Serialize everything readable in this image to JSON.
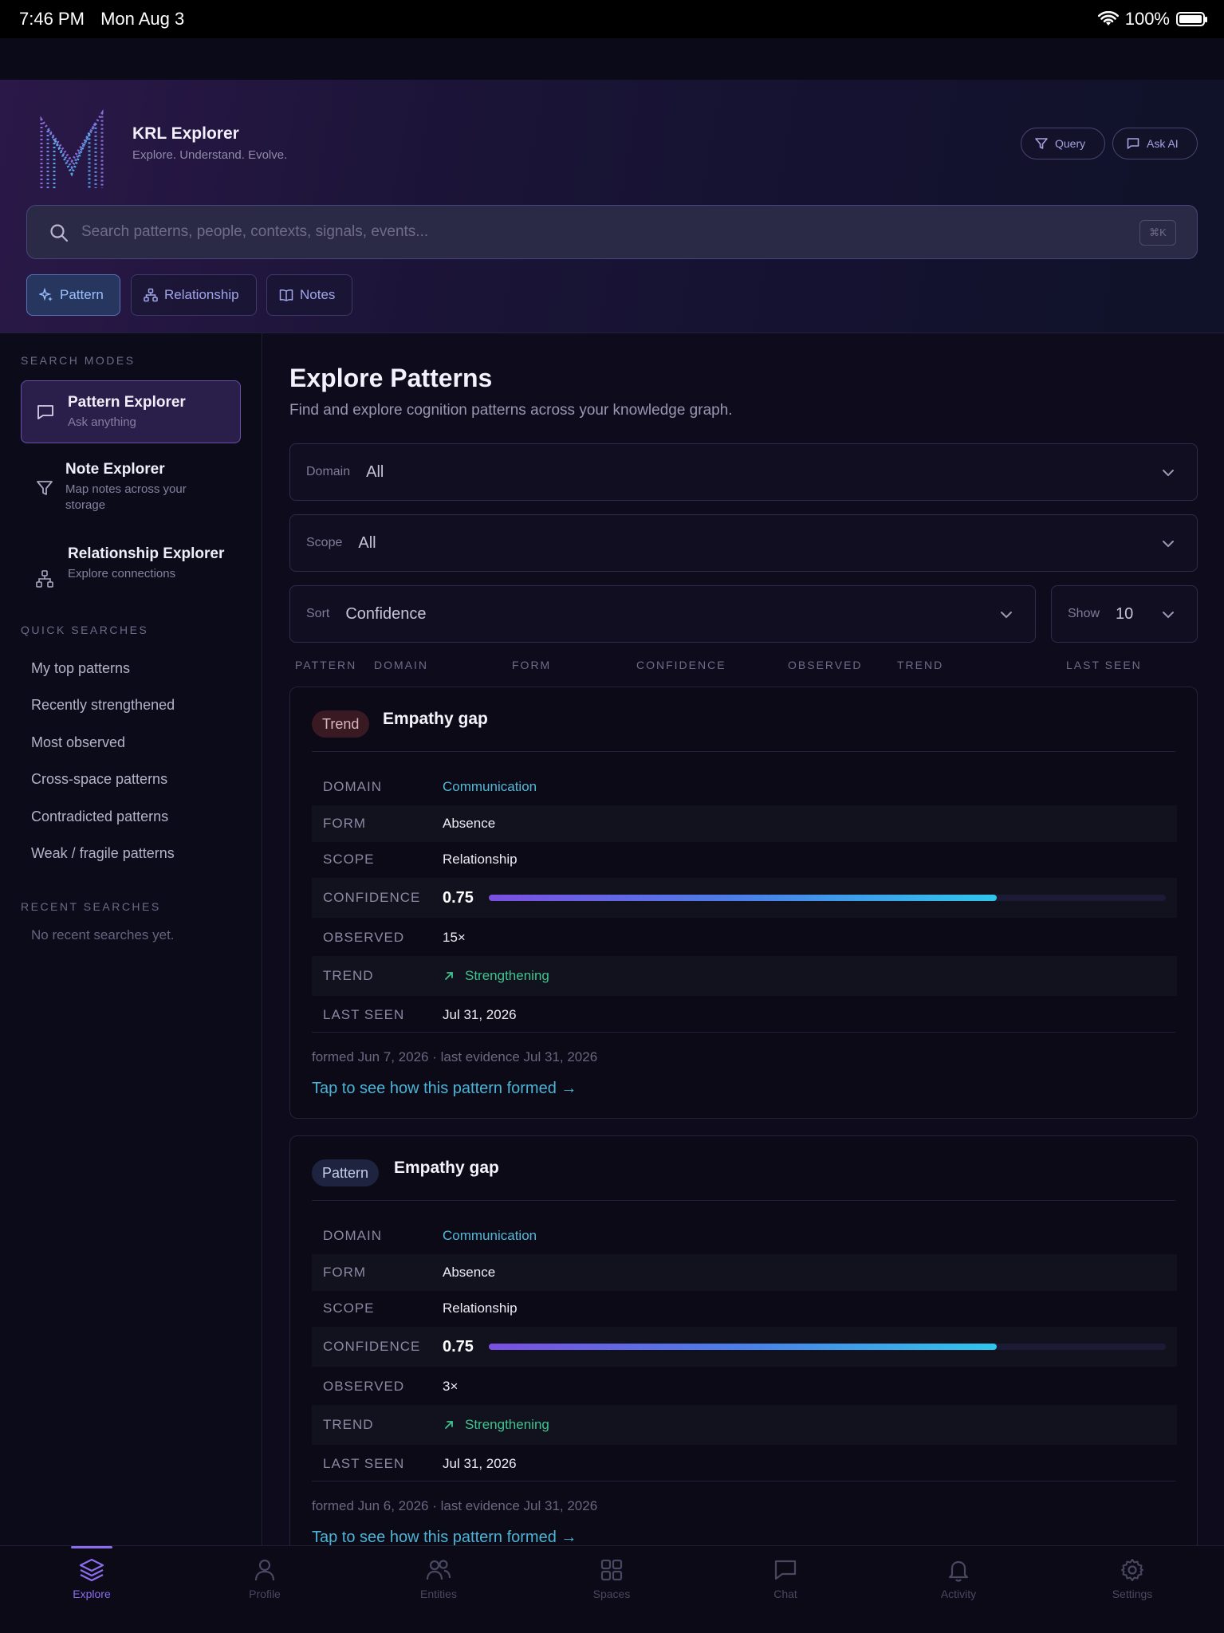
{
  "status": {
    "time": "7:46 PM",
    "date": "Mon Aug 3",
    "battery": "100%"
  },
  "brand": {
    "title": "KRL Explorer",
    "subtitle": "Explore. Understand. Evolve."
  },
  "header_buttons": {
    "query": "Query",
    "ask_ai": "Ask AI"
  },
  "search": {
    "placeholder": "Search patterns, people, contexts, signals, events...",
    "shortcut": "⌘K"
  },
  "tabs": [
    {
      "label": "Pattern",
      "active": true
    },
    {
      "label": "Relationship",
      "active": false
    },
    {
      "label": "Notes",
      "active": false
    }
  ],
  "sidebar": {
    "search_modes_label": "SEARCH MODES",
    "modes": [
      {
        "title": "Pattern Explorer",
        "subtitle": "Ask anything",
        "active": true
      },
      {
        "title": "Note Explorer",
        "subtitle": "Map notes across your storage",
        "active": false
      },
      {
        "title": "Relationship Explorer",
        "subtitle": "Explore connections",
        "active": false
      }
    ],
    "quick_label": "QUICK SEARCHES",
    "quick": [
      "My top patterns",
      "Recently strengthened",
      "Most observed",
      "Cross-space patterns",
      "Contradicted patterns",
      "Weak / fragile patterns"
    ],
    "recent_label": "RECENT SEARCHES",
    "recent_empty": "No recent searches yet."
  },
  "main": {
    "title": "Explore Patterns",
    "subtitle": "Find and explore cognition patterns across your knowledge graph.",
    "filters": {
      "domain_label": "Domain",
      "domain_value": "All",
      "scope_label": "Scope",
      "scope_value": "All",
      "sort_label": "Sort",
      "sort_value": "Confidence",
      "show_label": "Show",
      "show_value": "10"
    },
    "columns": [
      "PATTERN",
      "DOMAIN",
      "FORM",
      "CONFIDENCE",
      "OBSERVED",
      "TREND",
      "LAST SEEN"
    ]
  },
  "field_labels": {
    "domain": "DOMAIN",
    "form": "FORM",
    "scope": "SCOPE",
    "confidence": "CONFIDENCE",
    "observed": "OBSERVED",
    "trend": "TREND",
    "last_seen": "LAST SEEN"
  },
  "cards": [
    {
      "badge": "Trend",
      "title": "Empathy gap",
      "domain": "Communication",
      "form": "Absence",
      "scope": "Relationship",
      "confidence": 0.75,
      "confidence_text": "0.75",
      "observed": "15×",
      "trend": "Strengthening",
      "last_seen": "Jul 31, 2026",
      "meta": "formed Jun 7, 2026 · last evidence Jul 31, 2026",
      "cta": "Tap to see how this pattern formed →"
    },
    {
      "badge": "Pattern",
      "title": "Empathy gap",
      "domain": "Communication",
      "form": "Absence",
      "scope": "Relationship",
      "confidence": 0.75,
      "confidence_text": "0.75",
      "observed": "3×",
      "trend": "Strengthening",
      "last_seen": "Jul 31, 2026",
      "meta": "formed Jun 6, 2026 · last evidence Jul 31, 2026",
      "cta": "Tap to see how this pattern formed →"
    }
  ],
  "tabbar": [
    {
      "label": "Explore",
      "icon": "layers-icon",
      "active": true
    },
    {
      "label": "Profile",
      "icon": "person-icon",
      "active": false
    },
    {
      "label": "Entities",
      "icon": "people-icon",
      "active": false
    },
    {
      "label": "Spaces",
      "icon": "grid-icon",
      "active": false
    },
    {
      "label": "Chat",
      "icon": "chat-icon",
      "active": false
    },
    {
      "label": "Activity",
      "icon": "bell-icon",
      "active": false
    },
    {
      "label": "Settings",
      "icon": "gear-icon",
      "active": false
    }
  ],
  "colors": {
    "accent": "#8b6cf0",
    "link": "#53b9d8",
    "positive": "#3fc48f"
  }
}
